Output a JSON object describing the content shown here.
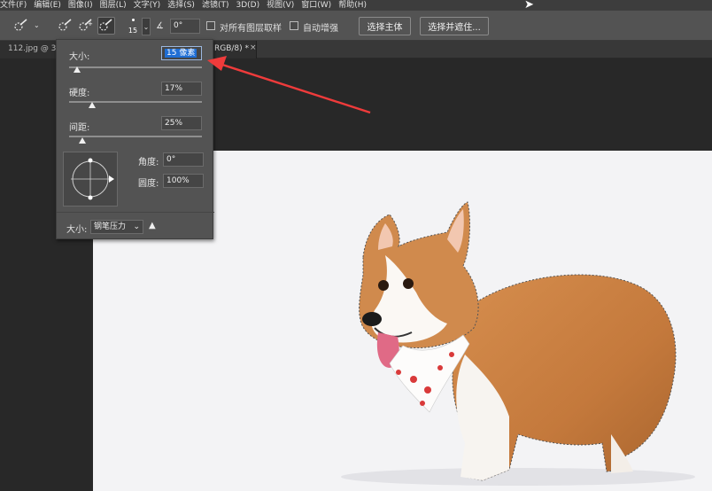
{
  "menu": [
    "文件(F)",
    "编辑(E)",
    "图像(I)",
    "图层(L)",
    "文字(Y)",
    "选择(S)",
    "滤镜(T)",
    "3D(D)",
    "视图(V)",
    "窗口(W)",
    "帮助(H)"
  ],
  "options_bar": {
    "brush_size_value": "15",
    "angle_value": "0°",
    "sample_all_layers_label": "对所有图层取样",
    "auto_enhance_label": "自动增强",
    "select_subject_label": "选择主体",
    "select_and_mask_label": "选择并遮住..."
  },
  "document_tab": {
    "name_left": "112.jpg @ 3",
    "name_right": "RGB/8) *",
    "close": "×"
  },
  "brush_popup": {
    "size_label": "大小:",
    "size_value": "15 像素",
    "hardness_label": "硬度:",
    "hardness_value": "17%",
    "spacing_label": "间距:",
    "spacing_value": "25%",
    "angle_label": "角度:",
    "angle_value": "0°",
    "roundness_label": "圆度:",
    "roundness_value": "100%",
    "pen_size_label": "大小:",
    "pen_size_option": "钢笔压力"
  },
  "sliders": {
    "size": 0.06,
    "hardness": 0.17,
    "spacing": 0.1
  },
  "colors": {
    "selection_highlight": "#1f6ed4",
    "annotation_arrow": "#ef3b3b"
  },
  "icons": [
    "quick-selection-icon",
    "add-to-selection-icon",
    "subtract-from-selection-icon",
    "angle-icon",
    "warning-icon",
    "mouse-cursor-icon"
  ]
}
